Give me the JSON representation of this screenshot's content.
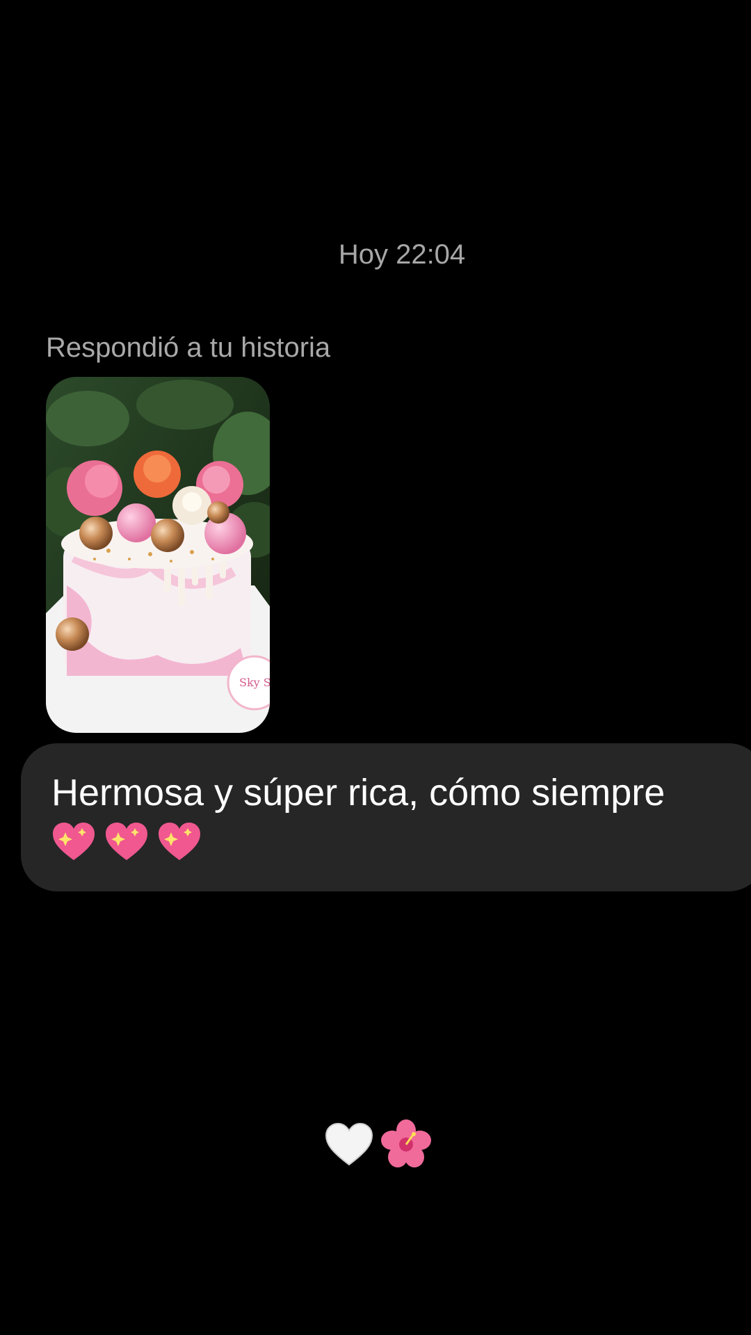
{
  "conversation": {
    "timestamp": "Hoy 22:04",
    "reply_label": "Respondió a tu historia",
    "message_text": "Hermosa y súper rica, cómo siempre",
    "message_emoji": [
      "sparkling-heart",
      "sparkling-heart",
      "sparkling-heart"
    ],
    "reactions": [
      "white-heart",
      "hibiscus"
    ]
  },
  "story": {
    "thumbnail_subject": "pink drip cake with flowers and gold spheres",
    "label_text": "Sky Sw"
  },
  "colors": {
    "background": "#000000",
    "bubble": "#262626",
    "timestamp_text": "#a7a7a7",
    "message_text": "#ffffff"
  }
}
